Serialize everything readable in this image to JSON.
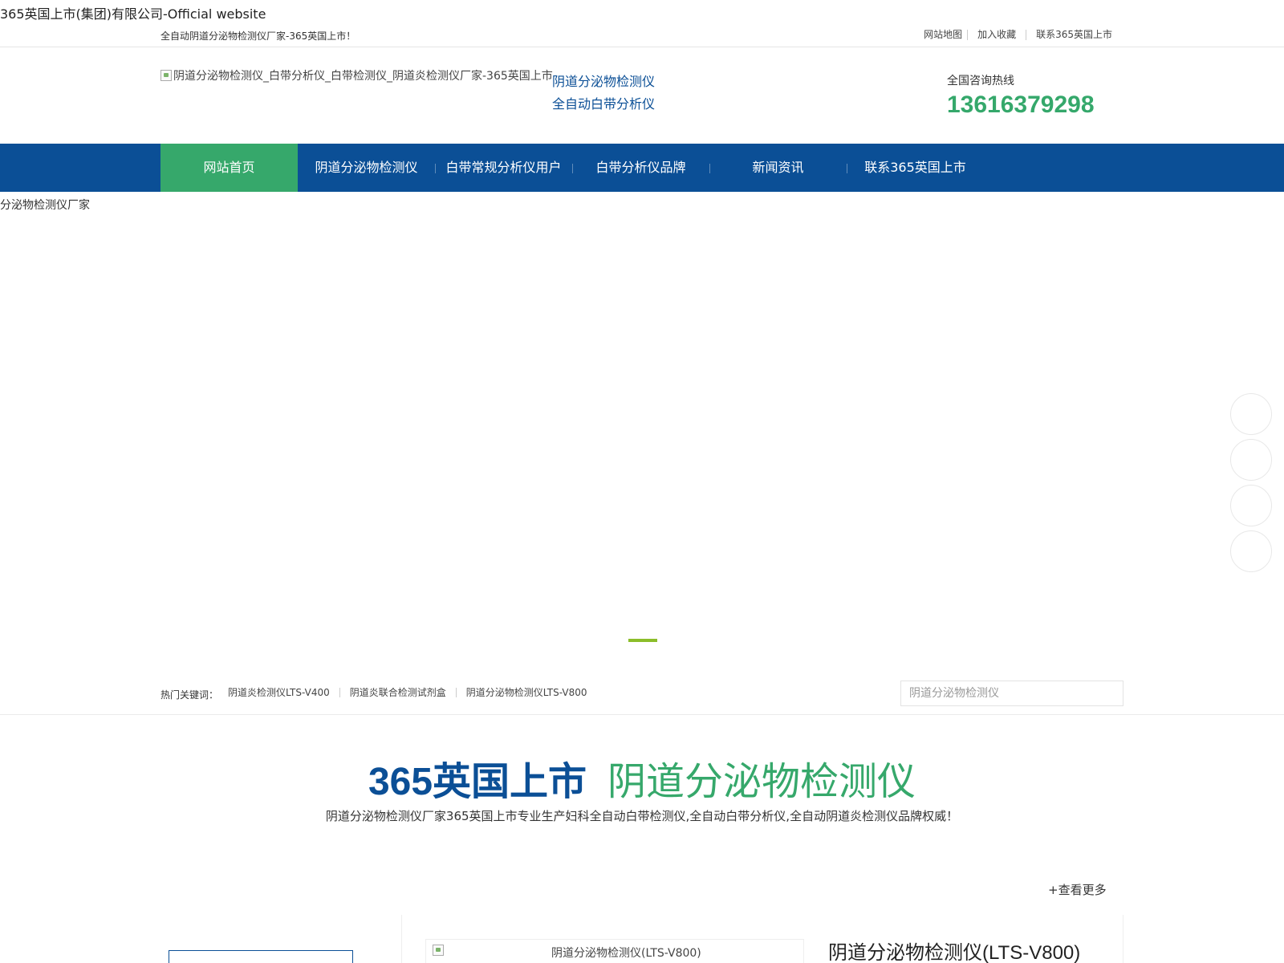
{
  "browser": {
    "title": "365英国上市(集团)有限公司-Official website"
  },
  "topbar": {
    "slogan": "全自动阴道分泌物检测仪厂家-365英国上市！",
    "links": [
      "网站地图",
      "加入收藏",
      "联系365英国上市"
    ]
  },
  "header": {
    "logo_alt": "阴道分泌物检测仪_白带分析仪_白带检测仪_阴道炎检测仪厂家-365英国上市",
    "tagline_1": "阴道分泌物检测仪",
    "tagline_2": "全自动白带分析仪",
    "hotline_label": "全国咨询热线",
    "hotline_number": "13616379298"
  },
  "nav": {
    "items": [
      "网站首页",
      "阴道分泌物检测仪",
      "白带常规分析仪用户",
      "白带分析仪品牌",
      "新闻资讯",
      "联系365英国上市"
    ],
    "active_index": 0
  },
  "banner": {
    "alt_text": "分泌物检测仪厂家"
  },
  "hot": {
    "label": "热门关键词：",
    "keywords": [
      "阴道炎检测仪LTS-V400",
      "阴道炎联合检测试剂盒",
      "阴道分泌物检测仪LTS-V800"
    ],
    "search_placeholder": "阴道分泌物检测仪"
  },
  "section": {
    "brand": "365英国上市",
    "product": "阴道分泌物检测仪",
    "description": "阴道分泌物检测仪厂家365英国上市专业生产妇科全自动白带检测仪,全自动白带分析仪,全自动阴道炎检测仪品牌权威！",
    "more": "+查看更多"
  },
  "product": {
    "image_caption": "阴道分泌物检测仪(LTS-V800)",
    "title": "阴道分泌物检测仪(LTS-V800)"
  },
  "colors": {
    "primary_blue": "#0b4f96",
    "accent_green": "#36a86b",
    "hotline_green": "#35a86b",
    "banner_indicator": "#8bbd2a"
  }
}
